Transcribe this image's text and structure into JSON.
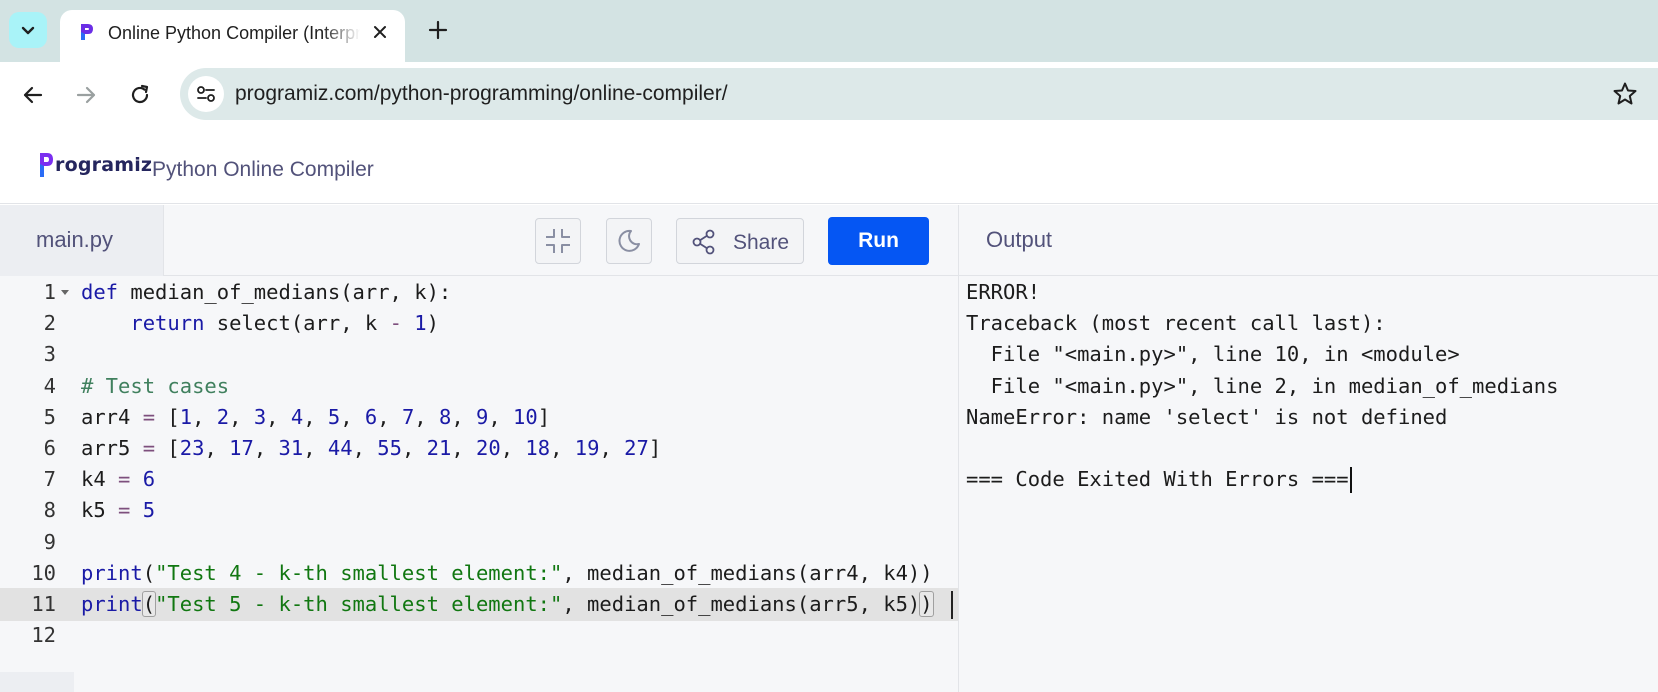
{
  "browser": {
    "tab_title": "Online Python Compiler (Interpreter) - Programiz",
    "url": "programiz.com/python-programming/online-compiler/",
    "icons": [
      "tab-search-icon",
      "programiz-favicon-icon",
      "close-icon",
      "plus-icon",
      "back-icon",
      "forward-icon",
      "reload-icon",
      "site-info-icon",
      "star-icon"
    ]
  },
  "header": {
    "logo_text": "rogramiz",
    "page_title": "Python Online Compiler"
  },
  "editor_bar": {
    "file_name": "main.py",
    "share_label": "Share",
    "run_label": "Run",
    "icons": [
      "minimize-icon",
      "dark-mode-icon",
      "share-icon"
    ]
  },
  "output_bar": {
    "title": "Output"
  },
  "code": {
    "line_numbers": [
      "1",
      "2",
      "3",
      "4",
      "5",
      "6",
      "7",
      "8",
      "9",
      "10",
      "11",
      "12"
    ],
    "active_line": 11,
    "lines": [
      [
        {
          "t": "kw",
          "v": "def"
        },
        {
          "t": "",
          "v": " median_of_medians(arr, k):"
        }
      ],
      [
        {
          "t": "",
          "v": "    "
        },
        {
          "t": "kw",
          "v": "return"
        },
        {
          "t": "",
          "v": " select(arr, k "
        },
        {
          "t": "op",
          "v": "-"
        },
        {
          "t": "",
          "v": " "
        },
        {
          "t": "num",
          "v": "1"
        },
        {
          "t": "",
          "v": ")"
        }
      ],
      [],
      [
        {
          "t": "cmt",
          "v": "# Test cases"
        }
      ],
      [
        {
          "t": "",
          "v": "arr4 "
        },
        {
          "t": "op",
          "v": "="
        },
        {
          "t": "",
          "v": " ["
        },
        {
          "t": "num",
          "v": "1"
        },
        {
          "t": "",
          "v": ", "
        },
        {
          "t": "num",
          "v": "2"
        },
        {
          "t": "",
          "v": ", "
        },
        {
          "t": "num",
          "v": "3"
        },
        {
          "t": "",
          "v": ", "
        },
        {
          "t": "num",
          "v": "4"
        },
        {
          "t": "",
          "v": ", "
        },
        {
          "t": "num",
          "v": "5"
        },
        {
          "t": "",
          "v": ", "
        },
        {
          "t": "num",
          "v": "6"
        },
        {
          "t": "",
          "v": ", "
        },
        {
          "t": "num",
          "v": "7"
        },
        {
          "t": "",
          "v": ", "
        },
        {
          "t": "num",
          "v": "8"
        },
        {
          "t": "",
          "v": ", "
        },
        {
          "t": "num",
          "v": "9"
        },
        {
          "t": "",
          "v": ", "
        },
        {
          "t": "num",
          "v": "10"
        },
        {
          "t": "",
          "v": "]"
        }
      ],
      [
        {
          "t": "",
          "v": "arr5 "
        },
        {
          "t": "op",
          "v": "="
        },
        {
          "t": "",
          "v": " ["
        },
        {
          "t": "num",
          "v": "23"
        },
        {
          "t": "",
          "v": ", "
        },
        {
          "t": "num",
          "v": "17"
        },
        {
          "t": "",
          "v": ", "
        },
        {
          "t": "num",
          "v": "31"
        },
        {
          "t": "",
          "v": ", "
        },
        {
          "t": "num",
          "v": "44"
        },
        {
          "t": "",
          "v": ", "
        },
        {
          "t": "num",
          "v": "55"
        },
        {
          "t": "",
          "v": ", "
        },
        {
          "t": "num",
          "v": "21"
        },
        {
          "t": "",
          "v": ", "
        },
        {
          "t": "num",
          "v": "20"
        },
        {
          "t": "",
          "v": ", "
        },
        {
          "t": "num",
          "v": "18"
        },
        {
          "t": "",
          "v": ", "
        },
        {
          "t": "num",
          "v": "19"
        },
        {
          "t": "",
          "v": ", "
        },
        {
          "t": "num",
          "v": "27"
        },
        {
          "t": "",
          "v": "]"
        }
      ],
      [
        {
          "t": "",
          "v": "k4 "
        },
        {
          "t": "op",
          "v": "="
        },
        {
          "t": "",
          "v": " "
        },
        {
          "t": "num",
          "v": "6"
        }
      ],
      [
        {
          "t": "",
          "v": "k5 "
        },
        {
          "t": "op",
          "v": "="
        },
        {
          "t": "",
          "v": " "
        },
        {
          "t": "num",
          "v": "5"
        }
      ],
      [],
      [
        {
          "t": "kw",
          "v": "print"
        },
        {
          "t": "",
          "v": "("
        },
        {
          "t": "str",
          "v": "\"Test 4 - k-th smallest element:\""
        },
        {
          "t": "",
          "v": ", median_of_medians(arr4, k4))"
        }
      ],
      [
        {
          "t": "kw",
          "v": "print"
        },
        {
          "t": "bracket",
          "v": "("
        },
        {
          "t": "str",
          "v": "\"Test 5 - k-th smallest element:\""
        },
        {
          "t": "",
          "v": ", median_of_medians(arr5, k5)"
        },
        {
          "t": "bracket",
          "v": ")"
        }
      ],
      []
    ]
  },
  "output": {
    "lines": [
      "ERROR!",
      "Traceback (most recent call last):",
      "  File \"<main.py>\", line 10, in <module>",
      "  File \"<main.py>\", line 2, in median_of_medians",
      "NameError: name 'select' is not defined",
      "",
      "=== Code Exited With Errors ==="
    ]
  }
}
